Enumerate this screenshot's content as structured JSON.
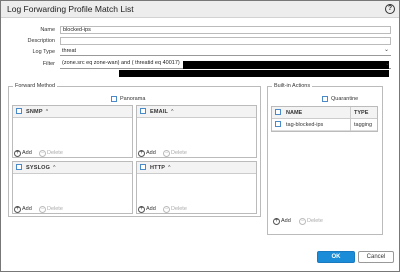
{
  "dialog": {
    "title": "Log Forwarding Profile Match List",
    "help_icon": "?"
  },
  "form": {
    "name_label": "Name",
    "name_value": "blocked-ips",
    "description_label": "Description",
    "description_value": "",
    "log_type_label": "Log Type",
    "log_type_value": "threat",
    "filter_label": "Filter",
    "filter_value": "(zone.src eq zone-wan) and ( threatid eq 40017)"
  },
  "forward_method": {
    "title": "Forward Method",
    "panorama_label": "Panorama",
    "panorama_checked": false,
    "tables": [
      {
        "header": "SNMP",
        "sort": "^"
      },
      {
        "header": "EMAIL",
        "sort": "^"
      },
      {
        "header": "SYSLOG",
        "sort": "^"
      },
      {
        "header": "HTTP",
        "sort": "^"
      }
    ],
    "add_label": "Add",
    "delete_label": "Delete"
  },
  "builtin_actions": {
    "title": "Built-in Actions",
    "quarantine_label": "Quarantine",
    "quarantine_checked": false,
    "columns": {
      "name": "NAME",
      "type": "TYPE"
    },
    "rows": [
      {
        "name": "tag-blocked-ips",
        "type": "tagging"
      }
    ],
    "add_label": "Add",
    "delete_label": "Delete"
  },
  "buttons": {
    "ok": "OK",
    "cancel": "Cancel"
  },
  "colors": {
    "accent": "#1a8cd8",
    "checkbox_border": "#4a8ac9"
  }
}
